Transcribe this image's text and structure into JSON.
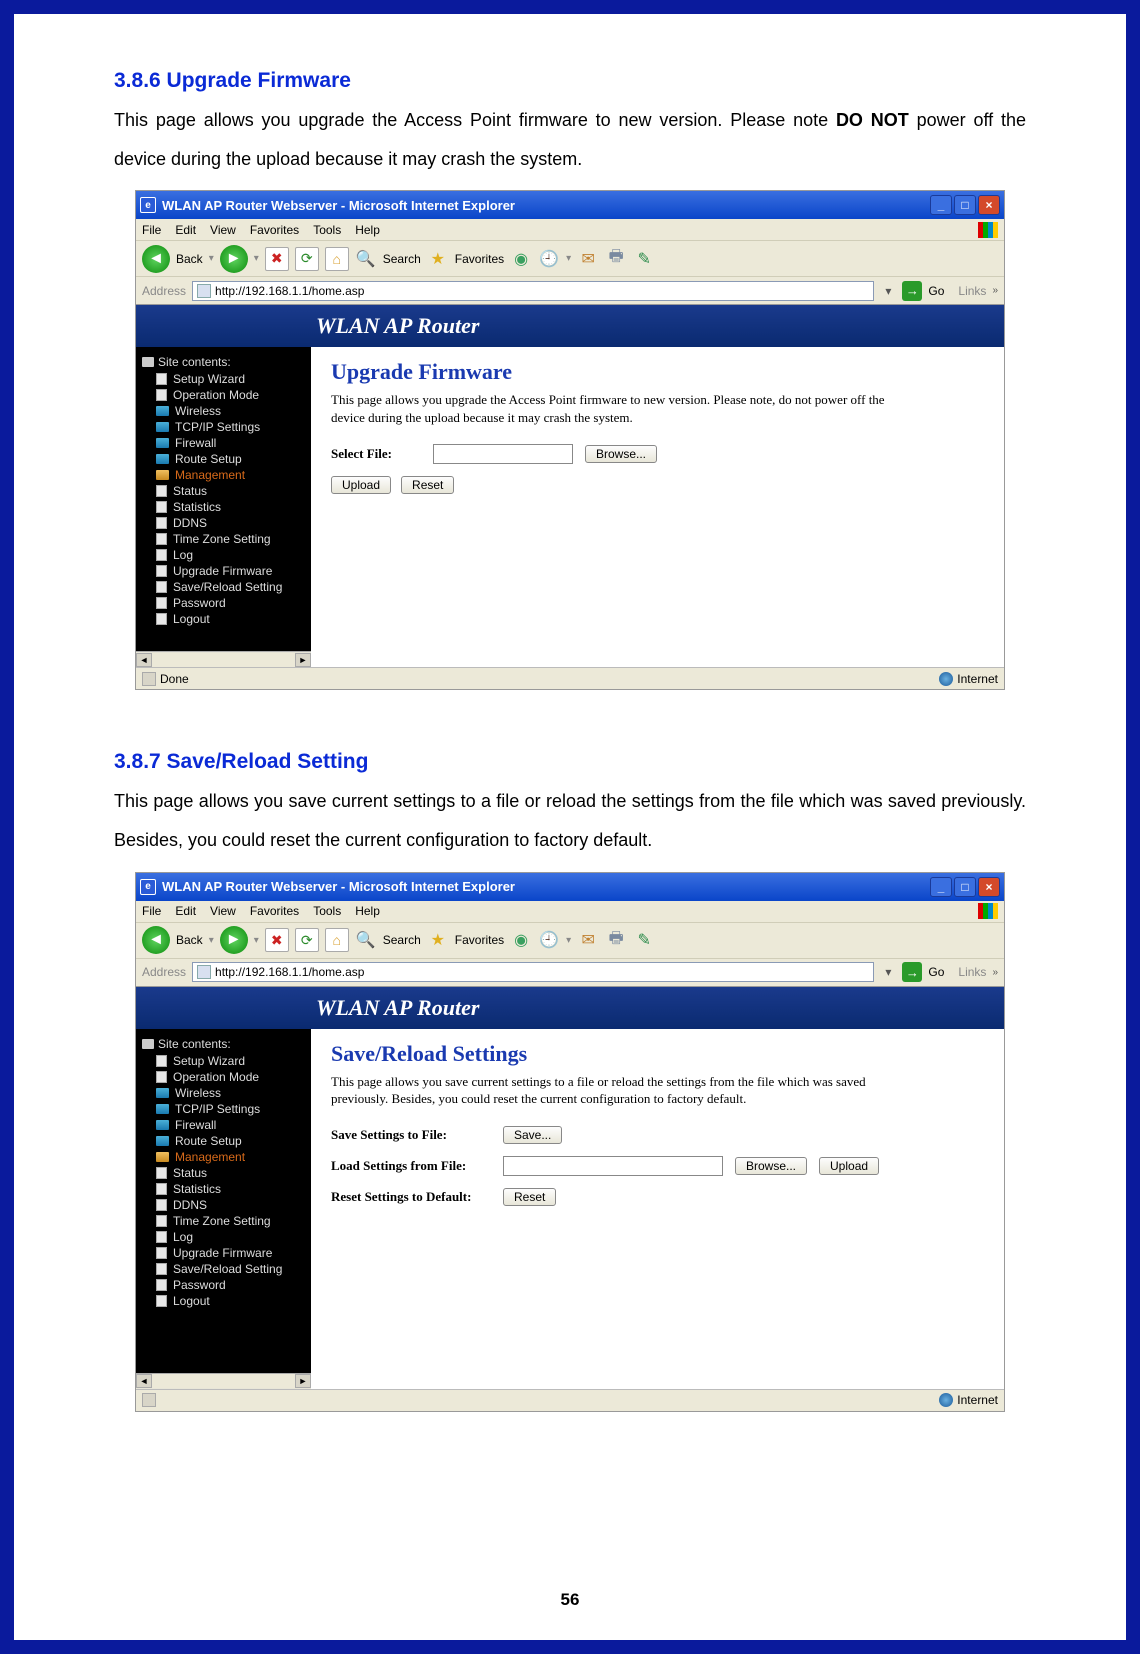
{
  "page_number": "56",
  "section1": {
    "heading": "3.8.6   Upgrade Firmware",
    "text_before_bold": "This page allows you upgrade the Access Point firmware to new version. Please note ",
    "bold": "DO NOT",
    "text_after_bold": " power off the device during the upload because it may crash the system."
  },
  "section2": {
    "heading": "3.8.7   Save/Reload Setting",
    "text": "This page allows you save current settings to a file or reload the settings from the file which was saved previously. Besides, you could reset the current configuration to factory default."
  },
  "ie": {
    "title": "WLAN AP Router Webserver - Microsoft Internet Explorer",
    "menus": [
      "File",
      "Edit",
      "View",
      "Favorites",
      "Tools",
      "Help"
    ],
    "back": "Back",
    "search": "Search",
    "favorites": "Favorites",
    "address_label": "Address",
    "address_url": "http://192.168.1.1/home.asp",
    "go": "Go",
    "links": "Links",
    "status_done": "Done",
    "status_zone": "Internet"
  },
  "router": {
    "banner": "WLAN AP Router",
    "sidebar_root": "Site contents:",
    "items_top": [
      "Setup Wizard",
      "Operation Mode",
      "Wireless",
      "TCP/IP Settings",
      "Firewall",
      "Route Setup"
    ],
    "mgmt_label": "Management",
    "items_mgmt": [
      "Status",
      "Statistics",
      "DDNS",
      "Time Zone Setting",
      "Log",
      "Upgrade Firmware",
      "Save/Reload Setting",
      "Password"
    ],
    "logout": "Logout"
  },
  "upgrade": {
    "title": "Upgrade Firmware",
    "desc": "This page allows you upgrade the Access Point firmware to new version. Please note, do not power off the device during the upload because it may crash the system.",
    "select_file": "Select File:",
    "browse": "Browse...",
    "upload": "Upload",
    "reset": "Reset"
  },
  "savereload": {
    "title": "Save/Reload Settings",
    "desc": "This page allows you save current settings to a file or reload the settings from the file which was saved previously. Besides, you could reset the current configuration to factory default.",
    "save_label": "Save Settings to File:",
    "save_btn": "Save...",
    "load_label": "Load Settings from File:",
    "browse": "Browse...",
    "upload": "Upload",
    "reset_label": "Reset Settings to Default:",
    "reset": "Reset"
  }
}
